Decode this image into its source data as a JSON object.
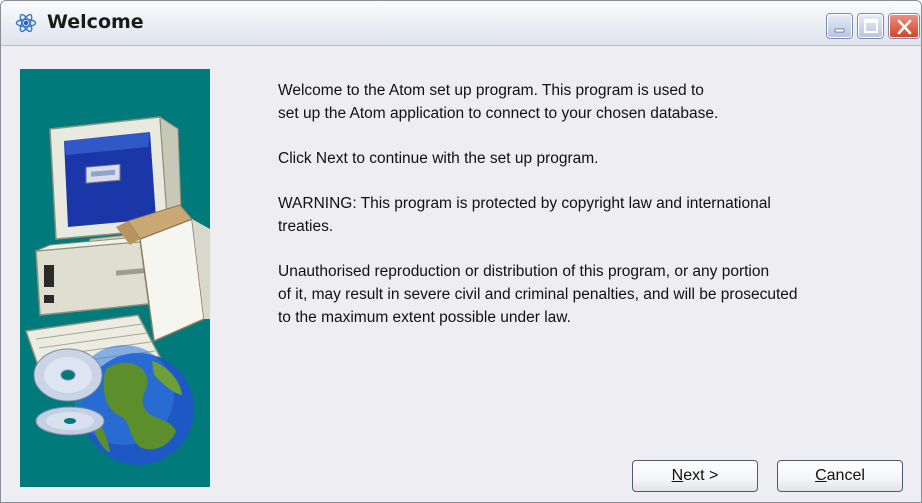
{
  "window": {
    "title": "Welcome",
    "app_icon": "atom-icon",
    "controls": {
      "minimize_icon": "minimize-icon",
      "maximize_icon": "maximize-icon",
      "close_icon": "close-icon"
    }
  },
  "banner": {
    "illustration": "computer-and-globe-illustration",
    "background_color": "#007a7a"
  },
  "content": {
    "paragraphs": [
      "Welcome to the Atom set up program. This program is used to set up the Atom application to connect to your chosen database.",
      "Click Next to continue with the set up program.",
      "WARNING: This program is protected by copyright law and international treaties.",
      "Unauthorised reproduction or distribution of this program, or any portion of it, may result in severe civil and criminal penalties, and will be prosecuted to the maximum extent possible under law."
    ],
    "lines": {
      "p1_l1": "Welcome to the Atom set up program. This program is used to",
      "p1_l2": "set up the Atom application to connect to your chosen database.",
      "p2_l1": "Click Next to continue with the set up program.",
      "p3_l1": "WARNING: This program is protected by copyright law and international",
      "p3_l2": "treaties.",
      "p4_l1": "Unauthorised reproduction or distribution of this program, or any portion",
      "p4_l2": "of it, may result in severe civil and criminal penalties, and will be prosecuted",
      "p4_l3": "to the maximum extent possible under law."
    }
  },
  "buttons": {
    "next": {
      "mnemonic": "N",
      "rest": "ext >"
    },
    "cancel": {
      "mnemonic": "C",
      "rest": "ancel"
    }
  }
}
